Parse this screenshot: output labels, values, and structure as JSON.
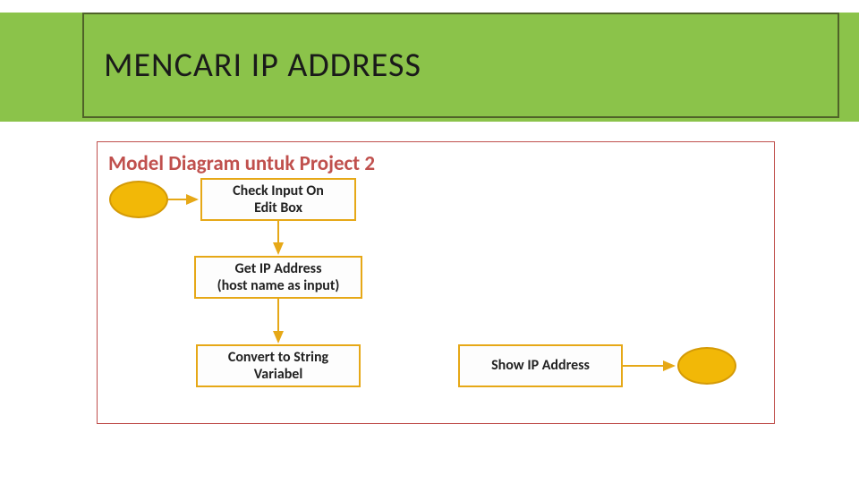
{
  "header": {
    "title": "MENCARI IP ADDRESS"
  },
  "diagram": {
    "subtitle": "Model Diagram untuk Project 2",
    "nodes": {
      "check_input": "Check Input On\nEdit Box",
      "get_ip": "Get IP Address\n(host name as input)",
      "convert": "Convert to String\nVariabel",
      "show_ip": "Show IP Address"
    },
    "shapes": {
      "start": "start-ellipse",
      "end": "end-ellipse"
    },
    "colors": {
      "header_bg": "#8BC34A",
      "title_border": "#4F6228",
      "content_border": "#C0504D",
      "node_border": "#E6A817",
      "ellipse_fill": "#F2B807",
      "arrow": "#E6A817"
    }
  }
}
